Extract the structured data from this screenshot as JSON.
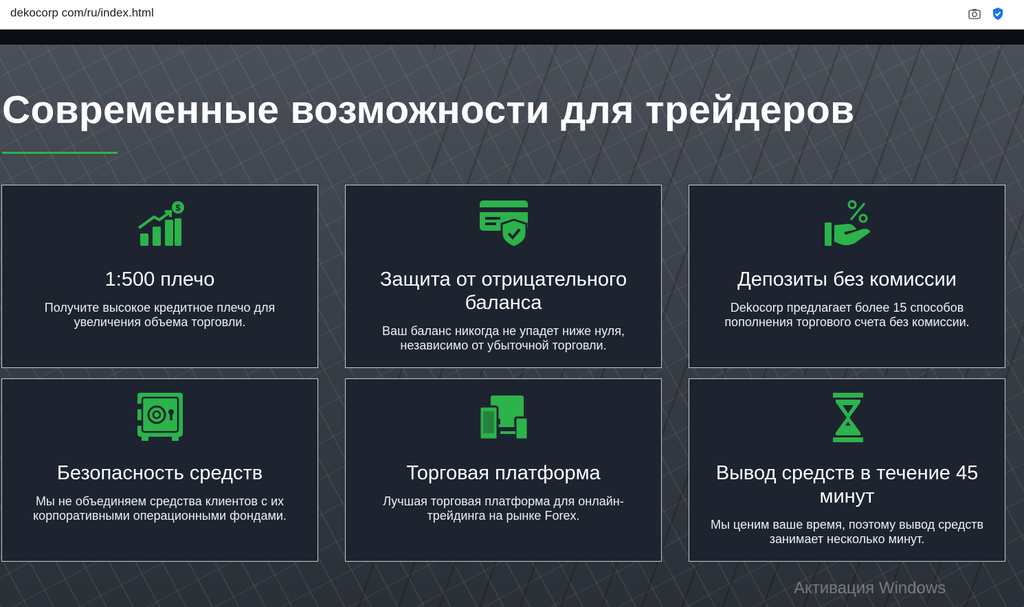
{
  "browser": {
    "url": "dekocorp com/ru/index.html"
  },
  "hero": {
    "heading": "Современные возможности для трейдеров"
  },
  "features": [
    {
      "icon": "chart-growth-icon",
      "title": "1:500 плечо",
      "desc": "Получите высокое кредитное плечо для увеличения объема торговли."
    },
    {
      "icon": "card-shield-icon",
      "title": "Защита от отрицательного баланса",
      "desc": "Ваш баланс никогда не упадет ниже нуля, независимо от убыточной торговли."
    },
    {
      "icon": "hand-percent-icon",
      "title": "Депозиты без комиссии",
      "desc": "Dekocorp предлагает более 15 способов пополнения торгового счета без комиссии."
    },
    {
      "icon": "safe-icon",
      "title": "Безопасность средств",
      "desc": "Мы не объединяем средства клиентов с их корпоративными операционными фондами."
    },
    {
      "icon": "devices-icon",
      "title": "Торговая платформа",
      "desc": "Лучшая торговая платформа для онлайн-трейдинга на рынке Forex."
    },
    {
      "icon": "hourglass-icon",
      "title": "Вывод средств в течение 45 минут",
      "desc": "Мы ценим ваше время, поэтому вывод средств занимает несколько минут."
    }
  ],
  "watermark": "Активация Windows",
  "colors": {
    "accent": "#2cb34a",
    "card_bg": "#1d2430",
    "card_border": "#c9ccd0"
  }
}
